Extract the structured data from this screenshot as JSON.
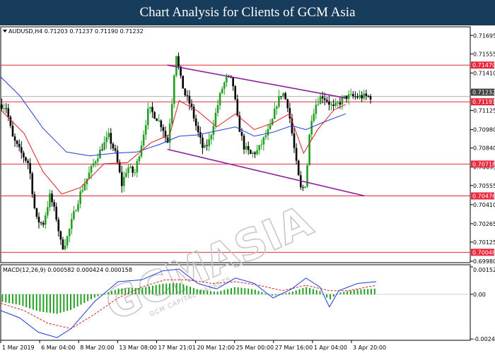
{
  "banner": {
    "title": "Chart Analysis for Clients of GCM Asia"
  },
  "watermark": {
    "brand": "GCMASIA",
    "tagline": "GCM CAPITAL MARKETS"
  },
  "chart_data": [
    {
      "type": "candlestick",
      "symbol_header": "AUDUSD,H4  0.71203 0.71237 0.71190 0.71232",
      "ylim": [
        0.6998,
        0.7175
      ],
      "y_ticks": [
        "0.71695",
        "0.71555",
        "0.71410",
        "0.71270",
        "0.71125",
        "0.70980",
        "0.70840",
        "0.70695",
        "0.70555",
        "0.70410",
        "0.70265",
        "0.70125",
        "0.69980"
      ],
      "x_ticks": [
        "1 Mar 2019",
        "6 Mar 04:00",
        "8 Mar 20:00",
        "13 Mar 08:00",
        "17 Mar 21:01",
        "20 Mar 12:00",
        "25 Mar 00:00",
        "27 Mar 16:00",
        "1 Apr 04:00",
        "3 Apr 20:00"
      ],
      "current_price": "0.71232",
      "current_price_color": "#404040",
      "horizontal_levels": [
        {
          "label": "0.71470",
          "value": 0.7147,
          "color": "#e8283c"
        },
        {
          "label": "0.71191",
          "value": 0.71191,
          "color": "#e8283c"
        },
        {
          "label": "0.70718",
          "value": 0.70718,
          "color": "#e8283c"
        },
        {
          "label": "0.70476",
          "value": 0.70476,
          "color": "#e8283c"
        },
        {
          "label": "0.70048",
          "value": 0.70048,
          "color": "#e8283c"
        }
      ],
      "channel_color": "#8b1f9c",
      "channel": {
        "upper": [
          [
            0.355,
            0.7147
          ],
          [
            0.735,
            0.7122
          ]
        ],
        "lower": [
          [
            0.355,
            0.7083
          ],
          [
            0.775,
            0.70476
          ]
        ]
      },
      "ma_red_color": "#dc1e1e",
      "ma_blue_color": "#1e3cdc",
      "bull_color": "#22a022",
      "bear_color": "#000000",
      "price_path": [
        [
          0.0,
          0.7117
        ],
        [
          0.012,
          0.7115
        ],
        [
          0.025,
          0.7092
        ],
        [
          0.04,
          0.7082
        ],
        [
          0.06,
          0.7072
        ],
        [
          0.075,
          0.703
        ],
        [
          0.09,
          0.7026
        ],
        [
          0.105,
          0.7048
        ],
        [
          0.118,
          0.7032
        ],
        [
          0.13,
          0.7008
        ],
        [
          0.14,
          0.7014
        ],
        [
          0.155,
          0.7033
        ],
        [
          0.17,
          0.705
        ],
        [
          0.185,
          0.7062
        ],
        [
          0.2,
          0.7074
        ],
        [
          0.215,
          0.7084
        ],
        [
          0.23,
          0.7093
        ],
        [
          0.245,
          0.7079
        ],
        [
          0.258,
          0.7056
        ],
        [
          0.27,
          0.707
        ],
        [
          0.285,
          0.7064
        ],
        [
          0.3,
          0.7088
        ],
        [
          0.315,
          0.7114
        ],
        [
          0.33,
          0.7108
        ],
        [
          0.345,
          0.71
        ],
        [
          0.355,
          0.7087
        ],
        [
          0.365,
          0.712
        ],
        [
          0.373,
          0.7158
        ],
        [
          0.382,
          0.7138
        ],
        [
          0.392,
          0.7125
        ],
        [
          0.405,
          0.7116
        ],
        [
          0.418,
          0.7098
        ],
        [
          0.432,
          0.7082
        ],
        [
          0.445,
          0.709
        ],
        [
          0.455,
          0.7106
        ],
        [
          0.47,
          0.7128
        ],
        [
          0.482,
          0.7138
        ],
        [
          0.494,
          0.7134
        ],
        [
          0.505,
          0.7104
        ],
        [
          0.518,
          0.7085
        ],
        [
          0.532,
          0.7079
        ],
        [
          0.548,
          0.7082
        ],
        [
          0.562,
          0.7092
        ],
        [
          0.575,
          0.71
        ],
        [
          0.588,
          0.7118
        ],
        [
          0.6,
          0.7127
        ],
        [
          0.612,
          0.7116
        ],
        [
          0.624,
          0.7086
        ],
        [
          0.632,
          0.7066
        ],
        [
          0.64,
          0.7051
        ],
        [
          0.65,
          0.7058
        ],
        [
          0.66,
          0.7105
        ],
        [
          0.672,
          0.7118
        ],
        [
          0.684,
          0.7124
        ],
        [
          0.696,
          0.712
        ],
        [
          0.708,
          0.7114
        ],
        [
          0.72,
          0.7118
        ],
        [
          0.735,
          0.7123
        ]
      ],
      "ma_red_path": [
        [
          0.0,
          0.7113
        ],
        [
          0.05,
          0.7095
        ],
        [
          0.09,
          0.7066
        ],
        [
          0.13,
          0.7049
        ],
        [
          0.17,
          0.7054
        ],
        [
          0.22,
          0.7072
        ],
        [
          0.27,
          0.7073
        ],
        [
          0.32,
          0.7088
        ],
        [
          0.36,
          0.7094
        ],
        [
          0.38,
          0.712
        ],
        [
          0.42,
          0.7112
        ],
        [
          0.46,
          0.71
        ],
        [
          0.5,
          0.711
        ],
        [
          0.54,
          0.7098
        ],
        [
          0.58,
          0.7103
        ],
        [
          0.615,
          0.711
        ],
        [
          0.645,
          0.708
        ],
        [
          0.675,
          0.7098
        ],
        [
          0.71,
          0.7113
        ],
        [
          0.735,
          0.7117
        ]
      ],
      "ma_blue_path": [
        [
          0.0,
          0.7138
        ],
        [
          0.04,
          0.7124
        ],
        [
          0.09,
          0.7099
        ],
        [
          0.14,
          0.7081
        ],
        [
          0.19,
          0.7078
        ],
        [
          0.24,
          0.708
        ],
        [
          0.29,
          0.7081
        ],
        [
          0.34,
          0.7087
        ],
        [
          0.38,
          0.7093
        ],
        [
          0.42,
          0.7094
        ],
        [
          0.46,
          0.7097
        ],
        [
          0.5,
          0.71
        ],
        [
          0.54,
          0.7093
        ],
        [
          0.58,
          0.7096
        ],
        [
          0.62,
          0.7101
        ],
        [
          0.65,
          0.7098
        ],
        [
          0.69,
          0.7104
        ],
        [
          0.735,
          0.711
        ]
      ]
    },
    {
      "type": "macd",
      "title": "MACD(12,26,9) 0.000582 0.000424 0.000158",
      "ylim": [
        -0.00247,
        0.00152
      ],
      "y_ticks": [
        "0.001521",
        "0.00",
        "-0.002473"
      ],
      "histogram_color": "#22a022",
      "histogram_bars": 110,
      "macd_color": "#1e3cdc",
      "signal_color": "#dc1e1e",
      "macd_path": [
        [
          0.0,
          -0.0009
        ],
        [
          0.04,
          -0.0013
        ],
        [
          0.08,
          -0.0021
        ],
        [
          0.12,
          -0.0024
        ],
        [
          0.15,
          -0.0019
        ],
        [
          0.2,
          -0.0004
        ],
        [
          0.25,
          0.0007
        ],
        [
          0.3,
          0.0008
        ],
        [
          0.345,
          0.0013
        ],
        [
          0.38,
          0.0014
        ],
        [
          0.42,
          0.0006
        ],
        [
          0.46,
          0.0003
        ],
        [
          0.5,
          0.0009
        ],
        [
          0.54,
          0.0006
        ],
        [
          0.58,
          -0.0002
        ],
        [
          0.62,
          0.0003
        ],
        [
          0.65,
          0.0009
        ],
        [
          0.68,
          0.0004
        ],
        [
          0.7,
          -0.0007
        ],
        [
          0.72,
          0.0002
        ],
        [
          0.76,
          0.0006
        ],
        [
          0.8,
          0.0007
        ]
      ],
      "signal_path": [
        [
          0.0,
          -0.0005
        ],
        [
          0.05,
          -0.0009
        ],
        [
          0.1,
          -0.0016
        ],
        [
          0.15,
          -0.0019
        ],
        [
          0.2,
          -0.0011
        ],
        [
          0.25,
          -0.0002
        ],
        [
          0.3,
          0.0004
        ],
        [
          0.35,
          0.0008
        ],
        [
          0.4,
          0.0008
        ],
        [
          0.45,
          0.0006
        ],
        [
          0.5,
          0.0007
        ],
        [
          0.55,
          0.0005
        ],
        [
          0.6,
          0.0002
        ],
        [
          0.65,
          0.0005
        ],
        [
          0.7,
          0.0002
        ],
        [
          0.74,
          0.0002
        ],
        [
          0.8,
          0.0005
        ]
      ]
    }
  ]
}
